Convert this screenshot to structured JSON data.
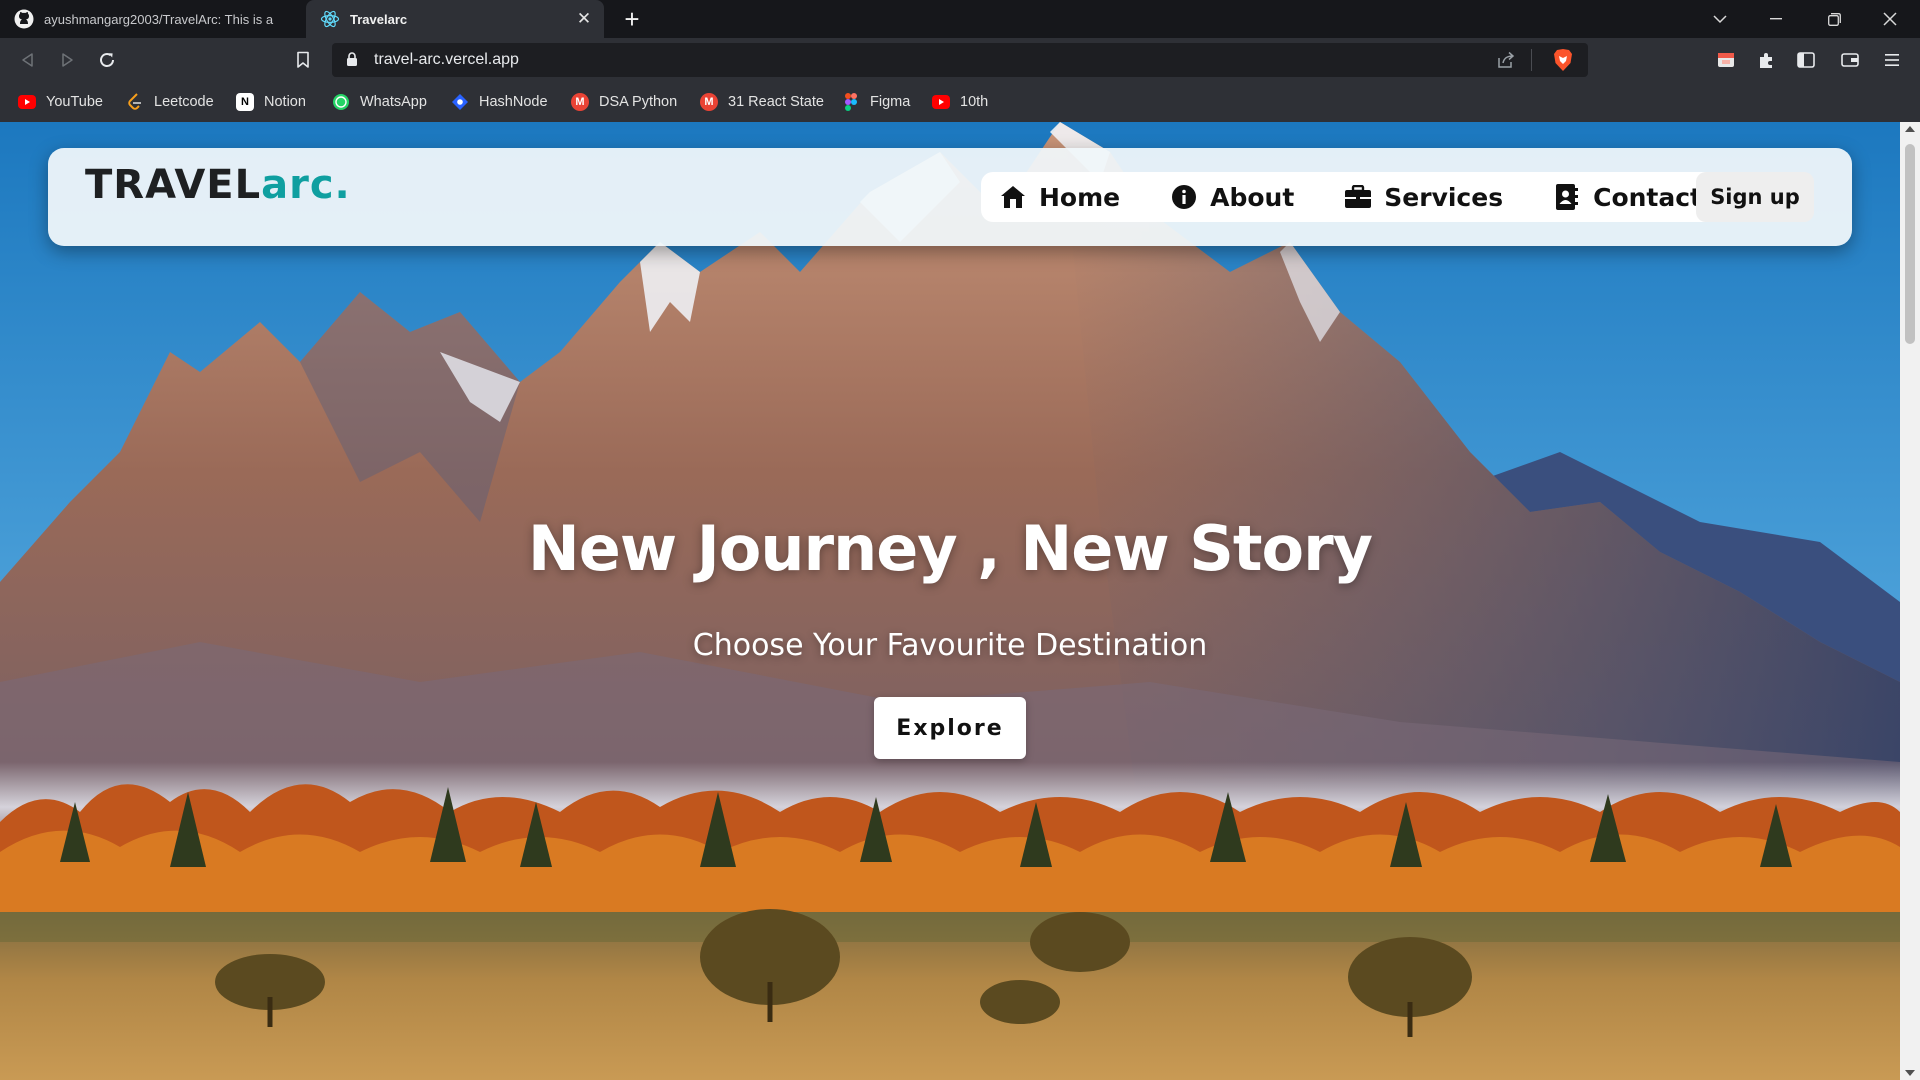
{
  "browser": {
    "tabs": [
      {
        "title": "ayushmangarg2003/TravelArc: This is a",
        "icon": "github-icon",
        "active": false
      },
      {
        "title": "Travelarc",
        "icon": "react-icon",
        "active": true
      }
    ],
    "close_tab_symbol": "✕",
    "new_tab_symbol": "+",
    "window_controls": [
      "chevron-down-icon",
      "minimize-icon",
      "restore-icon",
      "close-icon"
    ],
    "url": "travel-arc.vercel.app",
    "bookmarks": [
      {
        "label": "YouTube",
        "icon": "youtube-icon",
        "color": "#ff0000"
      },
      {
        "label": "Leetcode",
        "icon": "leetcode-icon",
        "color": "#f89f1b"
      },
      {
        "label": "Notion",
        "icon": "notion-icon",
        "color": "#ffffff"
      },
      {
        "label": "WhatsApp",
        "icon": "whatsapp-icon",
        "color": "#25d366"
      },
      {
        "label": "HashNode",
        "icon": "hashnode-icon",
        "color": "#2962ff"
      },
      {
        "label": "DSA Python",
        "icon": "gmail-icon",
        "color": "#ea4335"
      },
      {
        "label": "31 React State",
        "icon": "gmail-icon",
        "color": "#ea4335"
      },
      {
        "label": "Figma",
        "icon": "figma-icon",
        "color": "#f24e1e"
      },
      {
        "label": "10th",
        "icon": "youtube-icon",
        "color": "#ff0000"
      }
    ]
  },
  "site": {
    "logo": {
      "part1": "TRAVEL",
      "part2": "arc."
    },
    "nav": [
      {
        "label": "Home",
        "icon": "house-icon"
      },
      {
        "label": "About",
        "icon": "info-circle-icon"
      },
      {
        "label": "Services",
        "icon": "briefcase-icon"
      },
      {
        "label": "Contact",
        "icon": "address-book-icon"
      }
    ],
    "signup_label": "Sign up",
    "hero": {
      "title": "New Journey , New Story",
      "subtitle": "Choose Your Favourite Destination",
      "cta_label": "Explore"
    },
    "colors": {
      "accent": "#0f9fa0",
      "text": "#1e2022"
    }
  }
}
